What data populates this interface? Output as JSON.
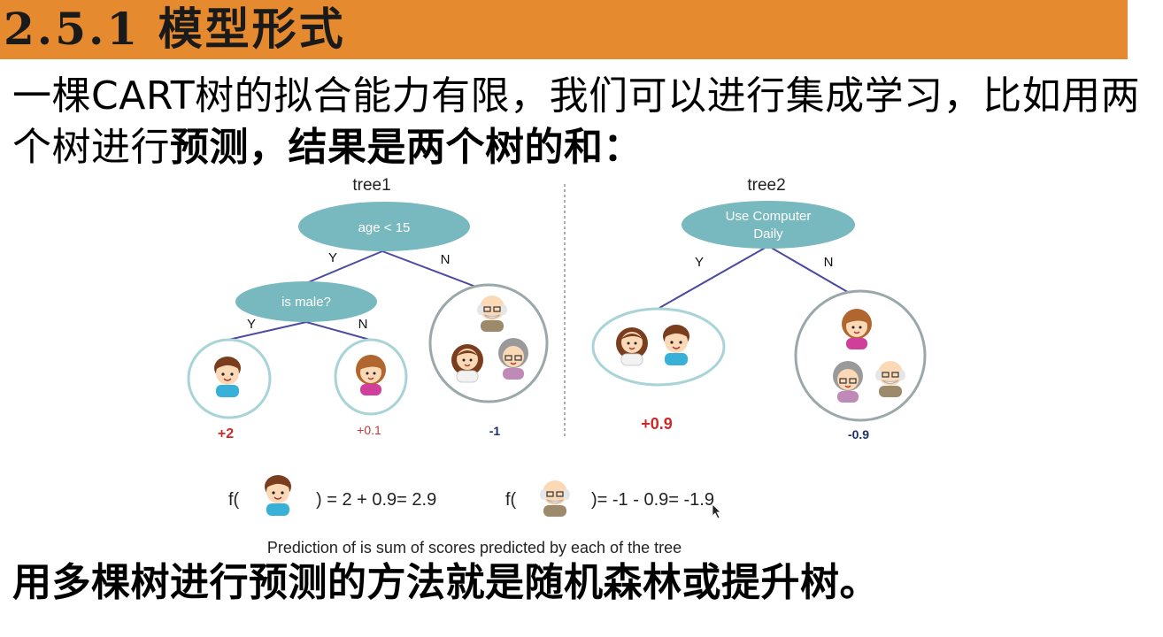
{
  "slide": {
    "title": "2.5.1 模型形式",
    "intro_part1": "一棵CART树的拟合能力有限，我们可以进行集成学习，比如用两个树进行",
    "intro_part2": "预测，结果是两个树的和：",
    "conclusion": "用多棵树进行预测的方法就是随机森林或提升树。"
  },
  "figure": {
    "tree1": {
      "label": "tree1",
      "root": "age < 15",
      "child": "is male?",
      "edge_y1": "Y",
      "edge_n1": "N",
      "edge_y2": "Y",
      "edge_n2": "N",
      "score_boy": "+2",
      "score_girl": "+0.1",
      "score_elders": "-1"
    },
    "tree2": {
      "label": "tree2",
      "root_line1": "Use Computer",
      "root_line2": "Daily",
      "edge_y": "Y",
      "edge_n": "N",
      "score_kids": "+0.9",
      "score_others": "-0.9"
    },
    "formula1_prefix": "f(",
    "formula1_rest": ") = 2 + 0.9= 2.9",
    "formula2_prefix": "f(",
    "formula2_rest": ")= -1 - 0.9= -1.9",
    "caption": "Prediction of is sum of scores predicted by each of the tree"
  },
  "colors": {
    "title_bar": "#e58a2e",
    "node_fill": "#78b8bf",
    "edge": "#4b4aa0",
    "circle_stroke": "#a8d4d8",
    "positive_score": "#d02828",
    "negative_score": "#1c2f6b"
  }
}
